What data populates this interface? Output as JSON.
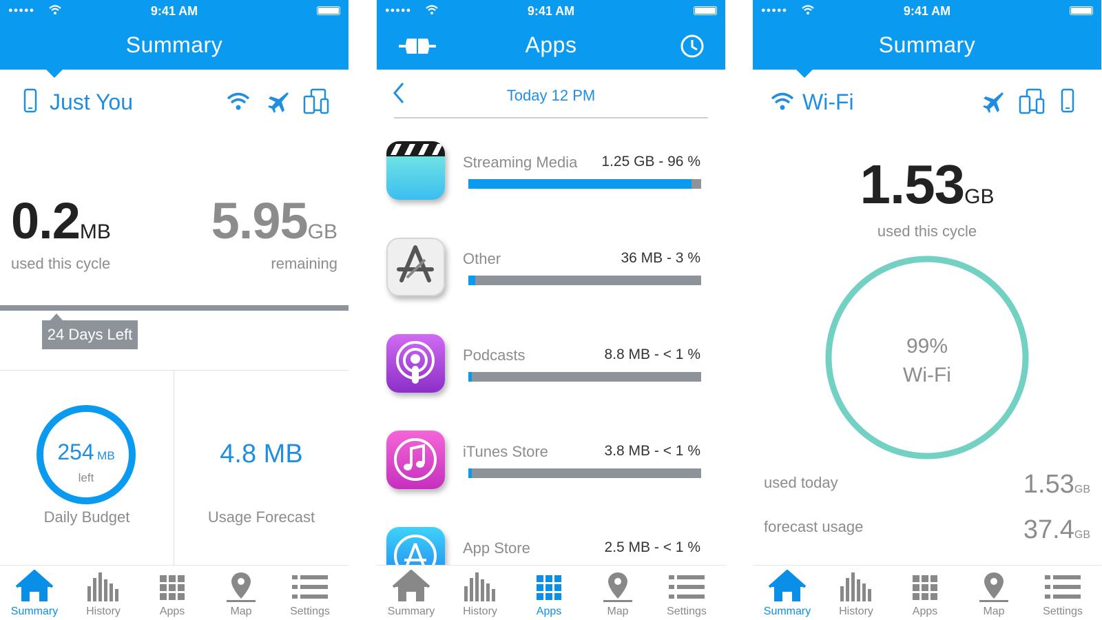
{
  "status": {
    "time": "9:41 AM"
  },
  "colors": {
    "accent": "#0a9bf0",
    "bar_bg": "#8e9399",
    "ring_teal": "#72d1c2"
  },
  "screen1": {
    "title": "Summary",
    "segment_label": "Just You",
    "used_value": "0.2",
    "used_unit": "MB",
    "used_caption": "used this cycle",
    "remaining_value": "5.95",
    "remaining_unit": "GB",
    "remaining_caption": "remaining",
    "days_left": "24 Days Left",
    "daily_budget_value": "254",
    "daily_budget_unit": "MB",
    "daily_budget_sub": "left",
    "daily_budget_label": "Daily Budget",
    "forecast_value": "4.8 MB",
    "forecast_label": "Usage Forecast"
  },
  "screen2": {
    "title": "Apps",
    "date": "Today 12 PM",
    "apps": [
      {
        "name": "Streaming Media",
        "value": "1.25 GB - 96 %",
        "percent": 96,
        "icon": "video-clapper-icon"
      },
      {
        "name": "Other",
        "value": "36 MB - 3 %",
        "percent": 3,
        "icon": "app-store-pencil-icon"
      },
      {
        "name": "Podcasts",
        "value": "8.8 MB - < 1 %",
        "percent": 1,
        "icon": "podcasts-icon"
      },
      {
        "name": "iTunes Store",
        "value": "3.8 MB - < 1 %",
        "percent": 0,
        "icon": "itunes-note-icon"
      },
      {
        "name": "App Store",
        "value": "2.5 MB - < 1 %",
        "percent": 0,
        "icon": "app-store-icon"
      }
    ]
  },
  "screen3": {
    "title": "Summary",
    "segment_label": "Wi-Fi",
    "used_value": "1.53",
    "used_unit": "GB",
    "used_caption": "used this cycle",
    "ring_percent": "99%",
    "ring_label": "Wi-Fi",
    "used_today_label": "used today",
    "used_today_value": "1.53",
    "used_today_unit": "GB",
    "forecast_label": "forecast usage",
    "forecast_value": "37.4",
    "forecast_unit": "GB"
  },
  "tabs": [
    "Summary",
    "History",
    "Apps",
    "Map",
    "Settings"
  ]
}
